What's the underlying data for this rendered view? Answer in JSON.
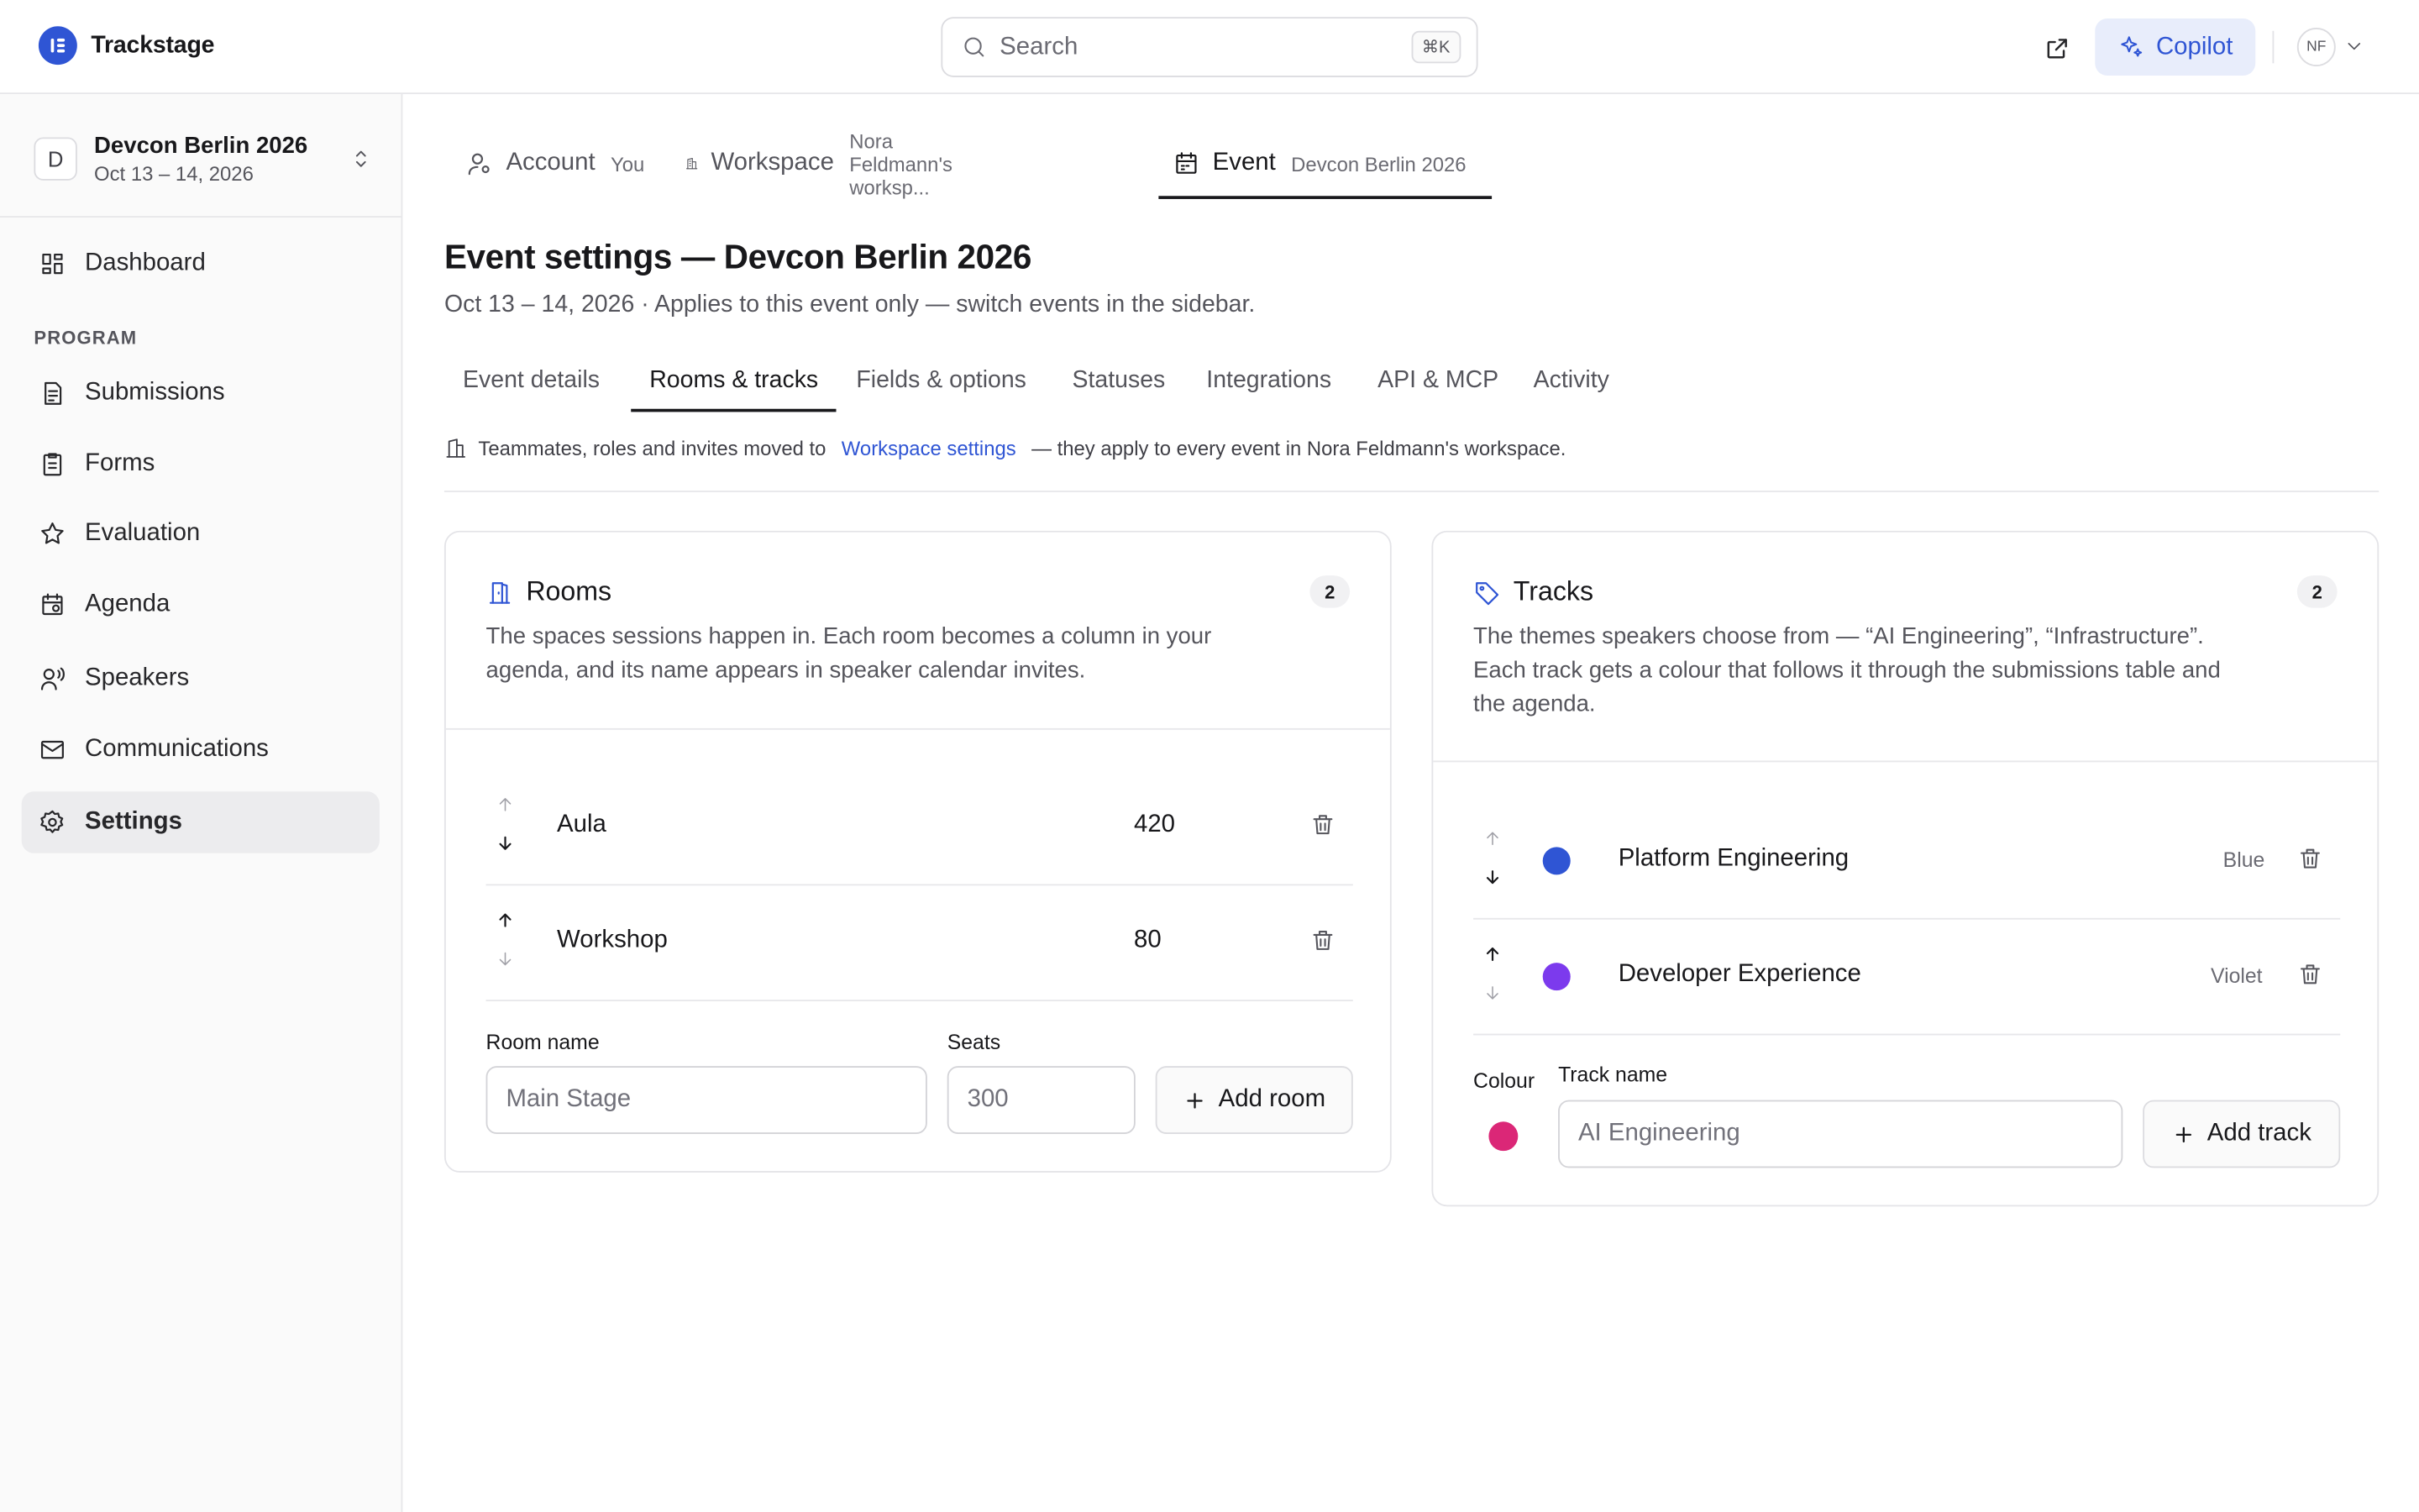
{
  "app": {
    "name": "Trackstage"
  },
  "search": {
    "placeholder": "Search",
    "shortcut": "⌘K"
  },
  "header": {
    "copilot_label": "Copilot",
    "user_initials": "NF"
  },
  "sidebar": {
    "event_initial": "D",
    "event_name": "Devcon Berlin 2026",
    "event_dates": "Oct 13 – 14, 2026",
    "items": [
      {
        "label": "Dashboard",
        "icon": "dashboard-icon"
      },
      {
        "label": "Submissions",
        "icon": "submissions-icon"
      },
      {
        "label": "Forms",
        "icon": "forms-icon"
      },
      {
        "label": "Evaluation",
        "icon": "star-icon"
      },
      {
        "label": "Agenda",
        "icon": "calendar-icon"
      },
      {
        "label": "Speakers",
        "icon": "speakers-icon"
      },
      {
        "label": "Communications",
        "icon": "mail-icon"
      },
      {
        "label": "Settings",
        "icon": "gear-icon",
        "active": true
      }
    ],
    "section_program": "PROGRAM"
  },
  "scope_tabs": [
    {
      "label": "Account",
      "sub": "You"
    },
    {
      "label": "Workspace",
      "sub": "Nora Feldmann's worksp..."
    },
    {
      "label": "Event",
      "sub": "Devcon Berlin 2026",
      "active": true
    }
  ],
  "page": {
    "title": "Event settings — Devcon Berlin 2026",
    "subtitle": "Oct 13 – 14, 2026 · Applies to this event only — switch events in the sidebar."
  },
  "section_tabs": [
    {
      "label": "Event details"
    },
    {
      "label": "Rooms & tracks",
      "active": true
    },
    {
      "label": "Fields & options"
    },
    {
      "label": "Statuses"
    },
    {
      "label": "Integrations"
    },
    {
      "label": "API & MCP"
    },
    {
      "label": "Activity"
    }
  ],
  "notice": {
    "before": "Teammates, roles and invites moved to",
    "link": "Workspace settings",
    "after": "— they apply to every event in Nora Feldmann's workspace."
  },
  "rooms": {
    "title": "Rooms",
    "count": "2",
    "description_1": "The spaces sessions happen in. Each room becomes a column in your",
    "description_2": "agenda, and its name appears in speaker calendar invites.",
    "items": [
      {
        "name": "Aula",
        "seats": "420"
      },
      {
        "name": "Workshop",
        "seats": "80"
      }
    ],
    "name_label": "Room name",
    "name_placeholder": "Main Stage",
    "seats_label": "Seats",
    "seats_placeholder": "300",
    "add_label": "Add room"
  },
  "tracks": {
    "title": "Tracks",
    "count": "2",
    "description_1": "The themes speakers choose from — “AI Engineering”, “Infrastructure”.",
    "description_2": "Each track gets a colour that follows it through the submissions table and",
    "description_3": "the agenda.",
    "items": [
      {
        "name": "Platform Engineering",
        "colour": "Blue",
        "hex": "#2f55d4"
      },
      {
        "name": "Developer Experience",
        "colour": "Violet",
        "hex": "#7c3aed"
      }
    ],
    "colour_label": "Colour",
    "new_colour_hex": "#db2777",
    "name_label": "Track name",
    "name_placeholder": "AI Engineering",
    "add_label": "Add track"
  },
  "colors": {
    "accent": "#2f55d4",
    "accent_bg": "#e8edfb"
  }
}
